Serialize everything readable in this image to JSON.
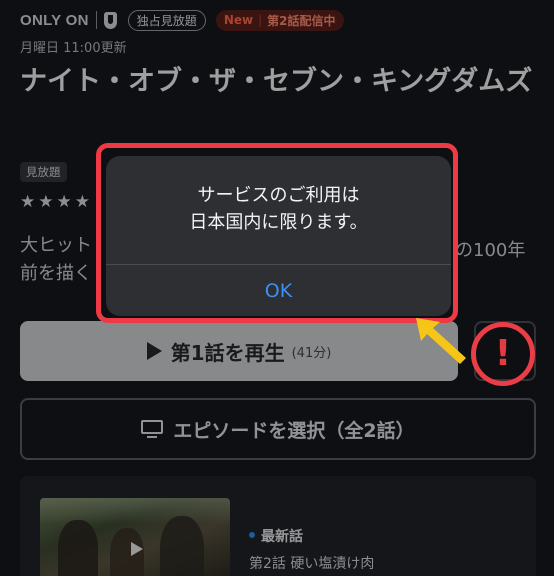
{
  "header": {
    "brand": "ONLY ON",
    "exclusive_badge": "独占見放題",
    "new_label": "New",
    "episode_label": "第2話配信中"
  },
  "updated": "月曜日 11:00更新",
  "title": "ナイト・オブ・ザ・セブン・キングダムズ",
  "free_badge": "見放題",
  "rating_stars": "★★★★",
  "description": {
    "line1": "大ヒット",
    "line2": "前を描く",
    "right_fragment": "の100年"
  },
  "play_button": {
    "label": "第1話を再生",
    "duration": "(41分)"
  },
  "episode_select": {
    "label": "エピソードを選択（全2話）"
  },
  "episode_card": {
    "latest": "最新話",
    "title": "第2話  硬い塩漬け肉"
  },
  "alert": {
    "line1": "サービスのご利用は",
    "line2": "日本国内に限ります。",
    "ok": "OK"
  },
  "annotation": {
    "mark": "!"
  },
  "colors": {
    "background": "#15181d",
    "highlight_red": "#ee3a44",
    "ok_blue": "#3d8ff5",
    "arrow_yellow": "#f5c518",
    "new_badge": "#ff6a4d"
  },
  "icons": [
    "u-next-logo-icon",
    "play-icon",
    "monitor-icon",
    "thumbnail-play-icon",
    "arrow-icon",
    "exclamation-icon"
  ]
}
